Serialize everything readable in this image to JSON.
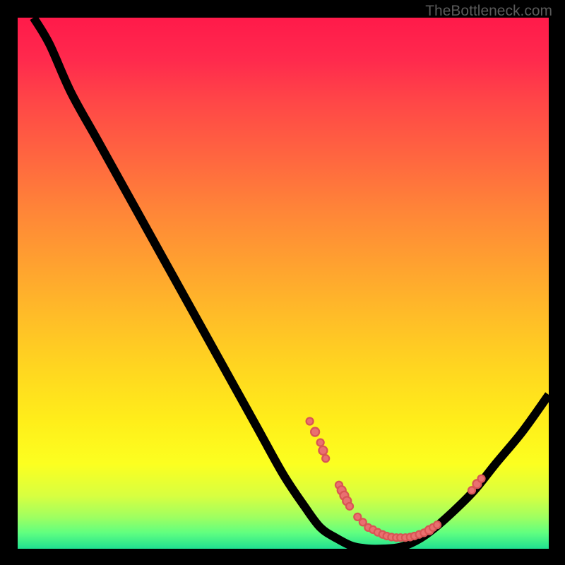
{
  "watermark": "TheBottleneck.com",
  "chart_data": {
    "type": "line",
    "title": "",
    "xlabel": "",
    "ylabel": "",
    "xlim": [
      0,
      100
    ],
    "ylim": [
      0,
      100
    ],
    "curve": [
      {
        "x": 3,
        "y": 100
      },
      {
        "x": 6,
        "y": 95
      },
      {
        "x": 10,
        "y": 86
      },
      {
        "x": 15,
        "y": 77
      },
      {
        "x": 20,
        "y": 68
      },
      {
        "x": 25,
        "y": 59
      },
      {
        "x": 30,
        "y": 50
      },
      {
        "x": 35,
        "y": 41
      },
      {
        "x": 40,
        "y": 32
      },
      {
        "x": 45,
        "y": 23
      },
      {
        "x": 50,
        "y": 14
      },
      {
        "x": 54,
        "y": 8
      },
      {
        "x": 57,
        "y": 4
      },
      {
        "x": 60,
        "y": 2
      },
      {
        "x": 63,
        "y": 0.5
      },
      {
        "x": 66,
        "y": 0
      },
      {
        "x": 69,
        "y": 0
      },
      {
        "x": 72,
        "y": 0.3
      },
      {
        "x": 75,
        "y": 1.5
      },
      {
        "x": 78,
        "y": 3.5
      },
      {
        "x": 82,
        "y": 7
      },
      {
        "x": 86,
        "y": 11
      },
      {
        "x": 90,
        "y": 16
      },
      {
        "x": 95,
        "y": 22
      },
      {
        "x": 100,
        "y": 29
      }
    ],
    "data_points": [
      {
        "x": 55,
        "y": 24,
        "r": 5
      },
      {
        "x": 56,
        "y": 22,
        "r": 6
      },
      {
        "x": 57,
        "y": 20,
        "r": 5
      },
      {
        "x": 57.5,
        "y": 18.5,
        "r": 6
      },
      {
        "x": 58,
        "y": 17,
        "r": 5
      },
      {
        "x": 60.5,
        "y": 12,
        "r": 5
      },
      {
        "x": 61,
        "y": 11,
        "r": 6
      },
      {
        "x": 61.5,
        "y": 10,
        "r": 6
      },
      {
        "x": 62,
        "y": 9,
        "r": 6
      },
      {
        "x": 62.5,
        "y": 8,
        "r": 5
      },
      {
        "x": 64,
        "y": 6,
        "r": 5
      },
      {
        "x": 65,
        "y": 5,
        "r": 5
      },
      {
        "x": 66,
        "y": 4,
        "r": 5
      },
      {
        "x": 66.9,
        "y": 3.6,
        "r": 5
      },
      {
        "x": 67.8,
        "y": 3.1,
        "r": 5
      },
      {
        "x": 68.7,
        "y": 2.7,
        "r": 5
      },
      {
        "x": 69.5,
        "y": 2.4,
        "r": 5
      },
      {
        "x": 70.4,
        "y": 2.2,
        "r": 5
      },
      {
        "x": 71.3,
        "y": 2.1,
        "r": 5
      },
      {
        "x": 72.1,
        "y": 2.1,
        "r": 5
      },
      {
        "x": 73,
        "y": 2.1,
        "r": 5
      },
      {
        "x": 73.9,
        "y": 2.2,
        "r": 5
      },
      {
        "x": 74.7,
        "y": 2.4,
        "r": 5
      },
      {
        "x": 75.6,
        "y": 2.7,
        "r": 5
      },
      {
        "x": 76.5,
        "y": 3,
        "r": 5
      },
      {
        "x": 77.5,
        "y": 3.5,
        "r": 6
      },
      {
        "x": 78.2,
        "y": 4,
        "r": 5
      },
      {
        "x": 79,
        "y": 4.5,
        "r": 5
      },
      {
        "x": 85.5,
        "y": 11,
        "r": 5
      },
      {
        "x": 86.5,
        "y": 12.2,
        "r": 6
      },
      {
        "x": 87.3,
        "y": 13.2,
        "r": 5
      }
    ],
    "background_gradient": {
      "top": "#ff1a4a",
      "middle": "#ffee1a",
      "bottom": "#20e090"
    }
  }
}
